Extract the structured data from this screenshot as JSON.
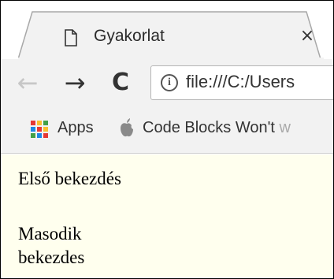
{
  "tab": {
    "title": "Gyakorlat",
    "close_glyph": "×",
    "icon": "page-icon"
  },
  "toolbar": {
    "back_glyph": "←",
    "forward_glyph": "→",
    "reload_glyph": "C",
    "info_glyph": "i",
    "url": "file:///C:/Users"
  },
  "bookmarks": {
    "apps_label": "Apps",
    "item_label": "Code Blocks Won't",
    "item_fade": " w",
    "apps_colors": [
      "#e53935",
      "#fbc02d",
      "#43a047",
      "#1e88e5",
      "#e53935",
      "#fbc02d",
      "#43a047",
      "#1e88e5",
      "#e53935"
    ]
  },
  "page": {
    "background": "#ffffee",
    "paragraph1": "Első bekezdés",
    "paragraph2": "Masodik bekezdes"
  }
}
